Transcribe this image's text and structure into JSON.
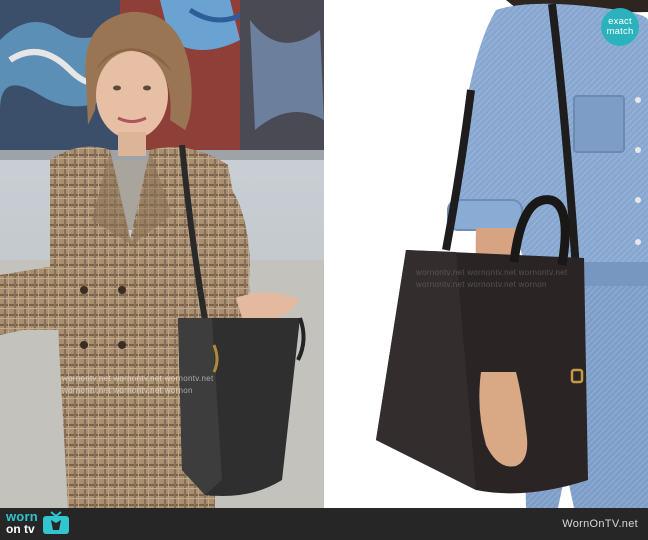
{
  "badge": {
    "line1": "exact",
    "line2": "match",
    "color": "#2ab3bd"
  },
  "watermark": {
    "lines": [
      "wornontv.net   wornontv.net   wornontv.net",
      "wornontv.net   wornontv.net   wornon"
    ]
  },
  "footer": {
    "logo_top": "worn",
    "logo_bottom": "on tv",
    "site": "WornOnTV.net",
    "logo_color": "#32c4cf",
    "background": "#262626"
  },
  "images": {
    "left_icon": "woman-in-plaid-coat-photo",
    "right_icon": "black-leather-tote-product-photo"
  }
}
